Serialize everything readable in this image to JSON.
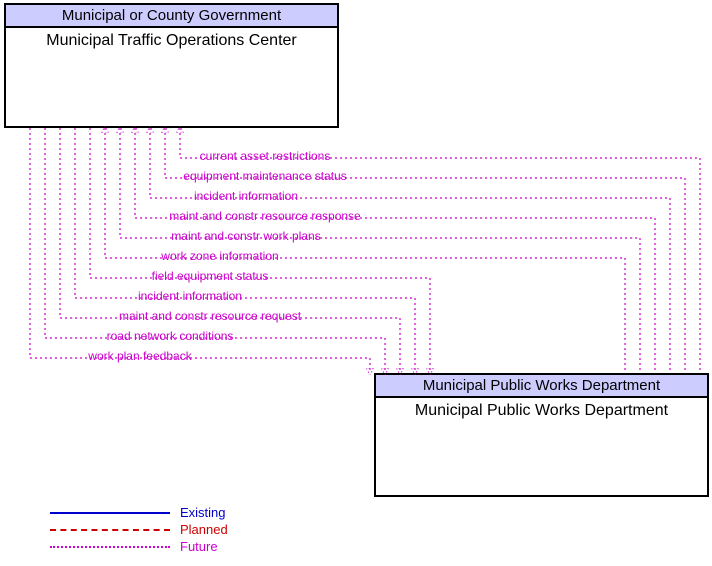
{
  "entity_top": {
    "header": "Municipal or County Government",
    "title": "Municipal Traffic Operations Center"
  },
  "entity_bottom": {
    "header": "Municipal Public Works Department",
    "title": "Municipal Public Works Department"
  },
  "flows_up": [
    "current asset restrictions",
    "equipment maintenance status",
    "incident information",
    "maint and constr resource response",
    "maint and constr work plans",
    "work zone information"
  ],
  "flows_down": [
    "field equipment status",
    "incident information",
    "maint and constr resource request",
    "road network conditions",
    "work plan feedback"
  ],
  "legend": {
    "existing": "Existing",
    "planned": "Planned",
    "future": "Future"
  },
  "chart_data": {
    "type": "diagram",
    "title": "Information flows between Municipal Traffic Operations Center and Municipal Public Works Department",
    "nodes": [
      {
        "id": "mtoc",
        "label": "Municipal Traffic Operations Center",
        "org": "Municipal or County Government"
      },
      {
        "id": "mpwd",
        "label": "Municipal Public Works Department",
        "org": "Municipal Public Works Department"
      }
    ],
    "edges": [
      {
        "from": "mpwd",
        "to": "mtoc",
        "label": "current asset restrictions",
        "status": "Future"
      },
      {
        "from": "mpwd",
        "to": "mtoc",
        "label": "equipment maintenance status",
        "status": "Future"
      },
      {
        "from": "mpwd",
        "to": "mtoc",
        "label": "incident information",
        "status": "Future"
      },
      {
        "from": "mpwd",
        "to": "mtoc",
        "label": "maint and constr resource response",
        "status": "Future"
      },
      {
        "from": "mpwd",
        "to": "mtoc",
        "label": "maint and constr work plans",
        "status": "Future"
      },
      {
        "from": "mpwd",
        "to": "mtoc",
        "label": "work zone information",
        "status": "Future"
      },
      {
        "from": "mtoc",
        "to": "mpwd",
        "label": "field equipment status",
        "status": "Future"
      },
      {
        "from": "mtoc",
        "to": "mpwd",
        "label": "incident information",
        "status": "Future"
      },
      {
        "from": "mtoc",
        "to": "mpwd",
        "label": "maint and constr resource request",
        "status": "Future"
      },
      {
        "from": "mtoc",
        "to": "mpwd",
        "label": "road network conditions",
        "status": "Future"
      },
      {
        "from": "mtoc",
        "to": "mpwd",
        "label": "work plan feedback",
        "status": "Future"
      }
    ],
    "legend": [
      {
        "label": "Existing",
        "style": "solid",
        "color": "#0000cc"
      },
      {
        "label": "Planned",
        "style": "dashed",
        "color": "#cc0000"
      },
      {
        "label": "Future",
        "style": "dotted",
        "color": "#cc00cc"
      }
    ]
  }
}
